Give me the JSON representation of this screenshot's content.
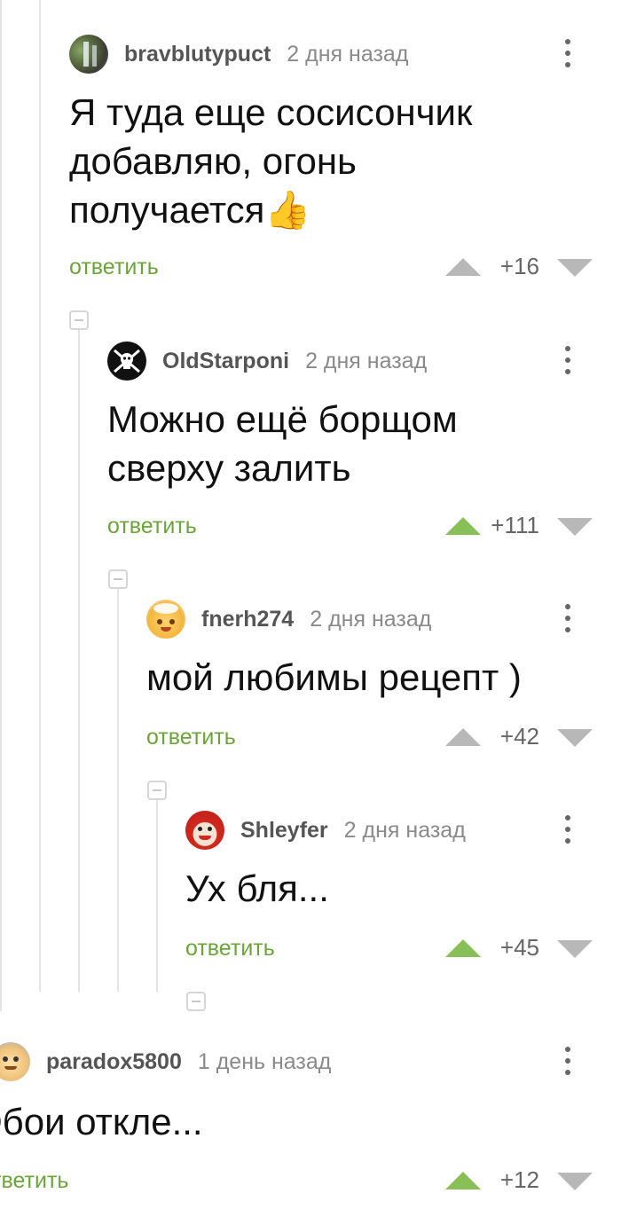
{
  "reply_label": "ответить",
  "reply_label_cut": "тветить",
  "colors": {
    "reply": "#6ba539",
    "vote_active": "#88c057",
    "vote_inactive": "#b8b8b8"
  },
  "comments": [
    {
      "username": "bravblutypuct",
      "time": "2 дня назад",
      "text": "Я туда еще сосисончик\nдобавляю, огонь\nполучается👍",
      "rating": "+16",
      "upvoted": false
    },
    {
      "username": "OldStarponi",
      "time": "2 дня назад",
      "text": "Можно ещё борщом\nсверху залить",
      "rating": "+111",
      "upvoted": true
    },
    {
      "username": "fnerh274",
      "time": "2 дня назад",
      "text": "мой любимы рецепт )",
      "rating": "+42",
      "upvoted": false
    },
    {
      "username": "Shleyfer",
      "time": "2 дня назад",
      "text": "Ух бля...",
      "rating": "+45",
      "upvoted": true
    },
    {
      "username": "paradox5800",
      "time": "1 день назад",
      "text": "Обои откле...",
      "rating": "+12",
      "upvoted": true
    }
  ]
}
